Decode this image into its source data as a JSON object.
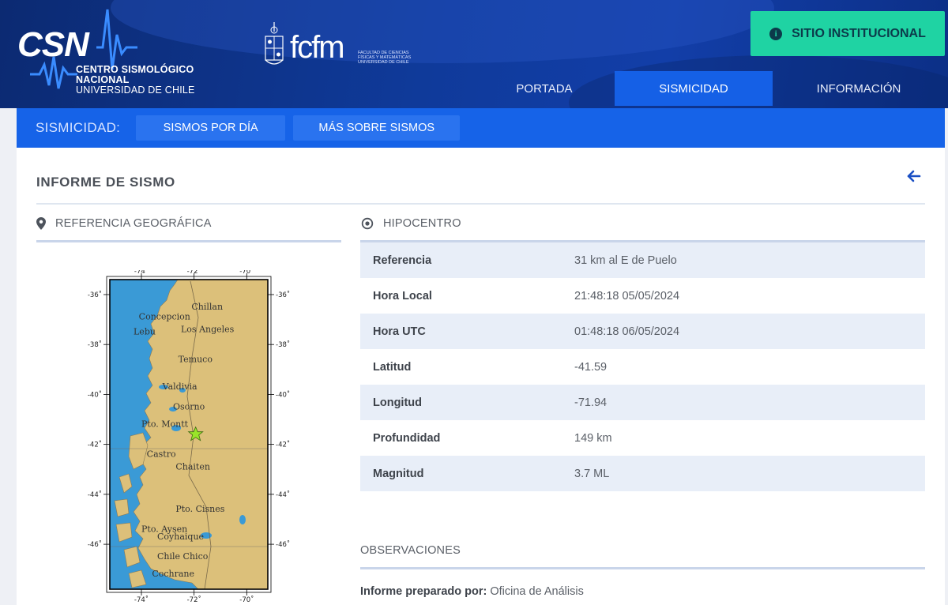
{
  "header": {
    "csn_letters": "CSN",
    "csn_name_line1": "CENTRO SISMOLÓGICO NACIONAL",
    "csn_name_line2": "UNIVERSIDAD DE CHILE",
    "fcfm_text": "fcfm",
    "fcfm_sub": "FACULTAD DE CIENCIAS FÍSICAS Y MATEMÁTICAS UNIVERSIDAD DE CHILE",
    "sitio_button": "SITIO INSTITUCIONAL",
    "nav": [
      {
        "label": "PORTADA"
      },
      {
        "label": "SISMICIDAD"
      },
      {
        "label": "INFORMACIÓN"
      }
    ]
  },
  "subbar": {
    "label": "SISMICIDAD:",
    "buttons": [
      {
        "label": "SISMOS POR DÍA"
      },
      {
        "label": "MÁS SOBRE SISMOS"
      }
    ]
  },
  "report": {
    "title": "INFORME DE SISMO",
    "geo_heading": "REFERENCIA GEOGRÁFICA",
    "hipo_heading": "HIPOCENTRO",
    "rows": [
      {
        "key": "Referencia",
        "value": "31 km al E de Puelo"
      },
      {
        "key": "Hora Local",
        "value": "21:48:18 05/05/2024"
      },
      {
        "key": "Hora UTC",
        "value": "01:48:18 06/05/2024"
      },
      {
        "key": "Latitud",
        "value": "-41.59"
      },
      {
        "key": "Longitud",
        "value": "-71.94"
      },
      {
        "key": "Profundidad",
        "value": "149 km"
      },
      {
        "key": "Magnitud",
        "value": "3.7 ML"
      }
    ],
    "obs_heading": "OBSERVACIONES",
    "obs_label": "Informe preparado por:",
    "obs_value": "Oficina de Análisis"
  },
  "map": {
    "lon_ticks": [
      "-74˚",
      "-72˚",
      "-70˚"
    ],
    "lat_ticks": [
      "-36˚",
      "-38˚",
      "-40˚",
      "-42˚",
      "-44˚",
      "-46˚"
    ],
    "cities": [
      "Chillan",
      "Concepcion",
      "Lebu",
      "Los Angeles",
      "Temuco",
      "Valdivia",
      "Osorno",
      "Pto. Montt",
      "Castro",
      "Chaiten",
      "Pto. Cisnes",
      "Pto. Aysen",
      "Coyhaique",
      "Chile Chico",
      "Cochrane"
    ],
    "epicenter_lat": -41.59,
    "epicenter_lon": -71.94
  },
  "colors": {
    "accent": "#1663e8",
    "teal": "#1fd3a3",
    "ocean": "#3a9ad6",
    "land": "#dcc07a"
  }
}
